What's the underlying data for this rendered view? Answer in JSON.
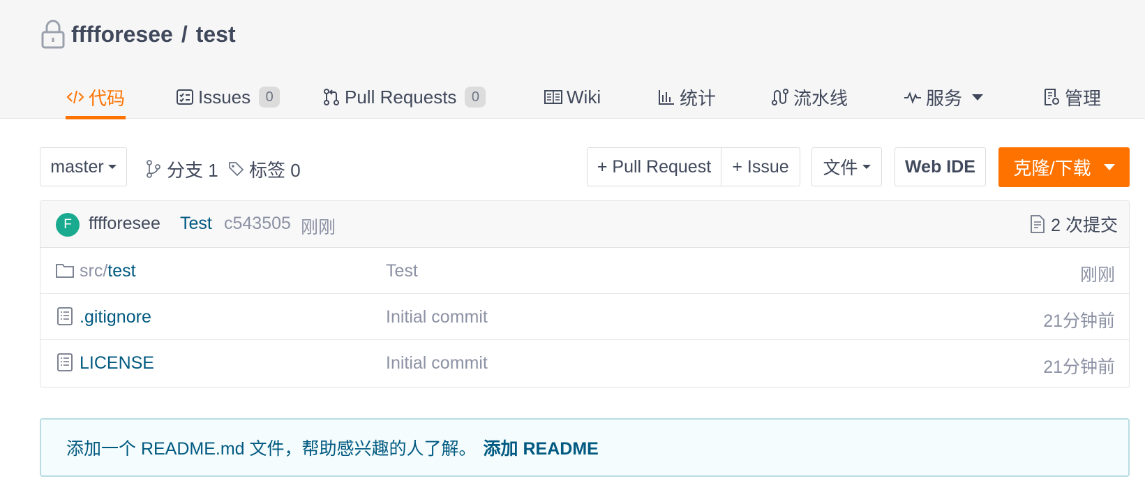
{
  "repo": {
    "owner": "fffforesee",
    "separator": "/",
    "name": "test"
  },
  "tabs": [
    {
      "label": "代码",
      "icon": "code-icon",
      "active": true
    },
    {
      "label": "Issues",
      "icon": "issues-icon",
      "badge": "0"
    },
    {
      "label": "Pull Requests",
      "icon": "pull-request-icon",
      "badge": "0"
    },
    {
      "label": "Wiki",
      "icon": "wiki-book-icon"
    },
    {
      "label": "统计",
      "icon": "bar-chart-icon"
    },
    {
      "label": "流水线",
      "icon": "pipeline-icon"
    },
    {
      "label": "服务",
      "icon": "pulse-icon",
      "dropdown": true
    },
    {
      "label": "管理",
      "icon": "settings-doc-icon"
    }
  ],
  "toolbar": {
    "branch_select": "master",
    "branches_label": "分支 1",
    "tags_label": "标签 0",
    "new_pr": "+ Pull Request",
    "new_issue": "+ Issue",
    "file_menu": "文件",
    "web_ide": "Web IDE",
    "clone_download": "克隆/下载"
  },
  "latest_commit": {
    "avatar_initial": "F",
    "author": "fffforesee",
    "message": "Test",
    "sha": "c543505",
    "time": "刚刚",
    "count_label": "2 次提交"
  },
  "files": [
    {
      "type": "folder",
      "dir_prefix": "src/",
      "name": "test",
      "message": "Test",
      "time": "刚刚"
    },
    {
      "type": "file",
      "dir_prefix": "",
      "name": ".gitignore",
      "message": "Initial commit",
      "time": "21分钟前"
    },
    {
      "type": "file",
      "dir_prefix": "",
      "name": "LICENSE",
      "message": "Initial commit",
      "time": "21分钟前"
    }
  ],
  "readme_banner": {
    "text": "添加一个 README.md 文件，帮助感兴趣的人了解。",
    "link": "添加 README"
  },
  "colors": {
    "accent": "#fe7300",
    "link": "#005980",
    "muted": "#8c92a4",
    "avatar": "#1aaa8f"
  }
}
